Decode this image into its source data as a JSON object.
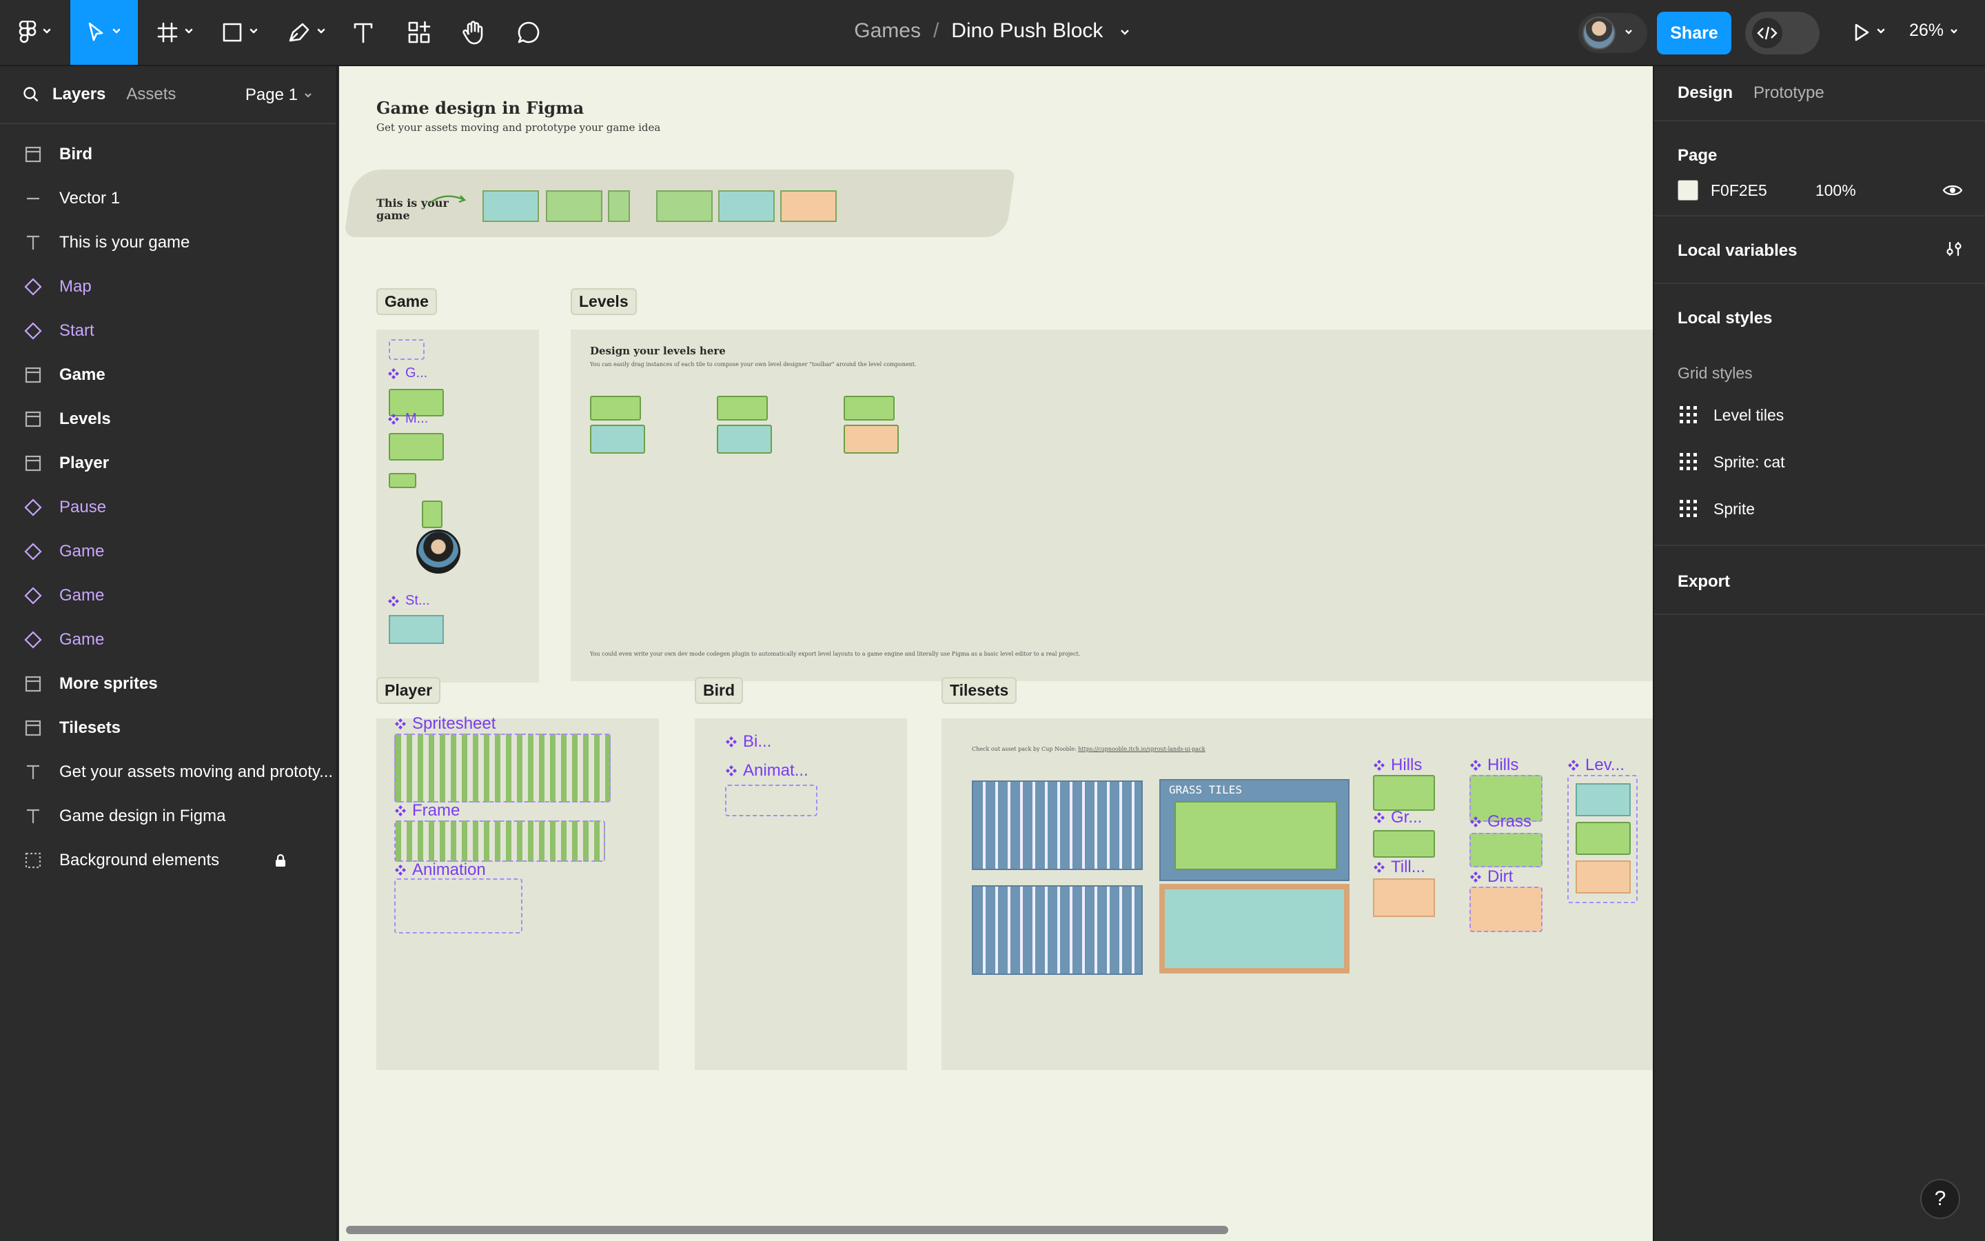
{
  "toolbar": {
    "project": "Games",
    "separator": "/",
    "file_name": "Dino Push Block",
    "share_label": "Share",
    "zoom": "26%",
    "tools": [
      "main-menu",
      "move-tool",
      "frame-tool",
      "shape-tool",
      "pen-tool",
      "text-tool",
      "resources-tool",
      "hand-tool",
      "comment-tool"
    ],
    "accent": "#0d99ff"
  },
  "left_panel": {
    "tabs": [
      "Layers",
      "Assets"
    ],
    "page_selector": "Page 1",
    "layers": [
      {
        "name": "Bird",
        "type": "frame"
      },
      {
        "name": "Vector 1",
        "type": "vector"
      },
      {
        "name": "This is your game",
        "type": "text"
      },
      {
        "name": "Map",
        "type": "component"
      },
      {
        "name": "Start",
        "type": "component"
      },
      {
        "name": "Game",
        "type": "frame"
      },
      {
        "name": "Levels",
        "type": "frame"
      },
      {
        "name": "Player",
        "type": "frame"
      },
      {
        "name": "Pause",
        "type": "component"
      },
      {
        "name": "Game",
        "type": "component"
      },
      {
        "name": "Game",
        "type": "component"
      },
      {
        "name": "Game",
        "type": "component"
      },
      {
        "name": "More sprites",
        "type": "frame"
      },
      {
        "name": "Tilesets",
        "type": "frame"
      },
      {
        "name": "Get your assets moving and prototy...",
        "type": "text"
      },
      {
        "name": "Game design in Figma",
        "type": "text"
      },
      {
        "name": "Background elements",
        "type": "group",
        "locked": true
      }
    ]
  },
  "right_panel": {
    "tabs": [
      "Design",
      "Prototype"
    ],
    "page_title": "Page",
    "page_color": "F0F2E5",
    "page_color_hex": "#f0f2e5",
    "page_opacity": "100%",
    "local_variables": "Local variables",
    "local_styles": "Local styles",
    "grid_styles_label": "Grid styles",
    "grid_styles": [
      "Level tiles",
      "Sprite: cat",
      "Sprite"
    ],
    "export": "Export",
    "help": "?"
  },
  "canvas": {
    "bg": "#f0f2e5",
    "heading": "Game design in Figma",
    "subheading": "Get your assets moving and prototype your game idea",
    "banner_text": "This is your game",
    "frames": {
      "game": "Game",
      "levels": "Levels",
      "player": "Player",
      "bird": "Bird",
      "tilesets": "Tilesets"
    },
    "levels_title": "Design your levels here",
    "levels_sub": "You can easily drag instances of each tile to compose your own level designer \"toolbar\" around the level component.",
    "levels_footer": "You could even write your own dev mode codegen plugin to automatically export level layouts to a game engine and literally use Figma as a basic level editor to a real project.",
    "game_labels": [
      "G...",
      "M...",
      "St..."
    ],
    "player_labels": [
      "Spritesheet",
      "Frame",
      "Animation"
    ],
    "bird_labels": [
      "Bi...",
      "Animat..."
    ],
    "tileset_labels": [
      "Hills",
      "Gr...",
      "Till...",
      "Hills",
      "Grass",
      "Dirt",
      "Lev..."
    ],
    "tileset_credit": "Check out asset pack by Cup Nooble:",
    "tileset_link": "https://cupnooble.itch.io/sprout-lands-ui-pack",
    "grass_tiles": "GRASS TILES"
  }
}
